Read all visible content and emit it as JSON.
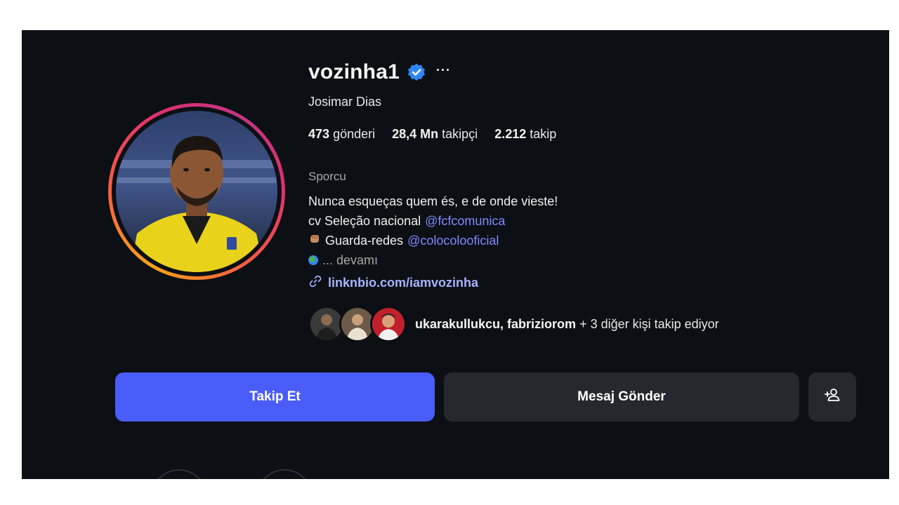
{
  "profile": {
    "username": "vozinha1",
    "full_name": "Josimar Dias",
    "more_label": "···",
    "verified_icon": "verified-badge-icon",
    "accent_color": "#4a5df9",
    "link_color": "#a5b4ff"
  },
  "stats": {
    "posts_count": "473",
    "posts_label": "gönderi",
    "followers_count": "28,4 Mn",
    "followers_label": "takipçi",
    "following_count": "2.212",
    "following_label": "takip"
  },
  "bio": {
    "category": "Sporcu",
    "line1": "Nunca esqueças quem és, e de onde vieste!",
    "line2_text": "cv Seleção nacional",
    "line2_mention": "@fcfcomunica",
    "line3_text": "Guarda-redes",
    "line3_mention": "@colocolooficial",
    "more": "... devamı",
    "link": "linknbio.com/iamvozinha"
  },
  "followed_by": {
    "names": "ukarakullukcu, fabriziorom",
    "rest": "+ 3 diğer kişi takip ediyor"
  },
  "actions": {
    "follow": "Takip Et",
    "message": "Mesaj Gönder",
    "add_icon": "add-person-icon"
  }
}
